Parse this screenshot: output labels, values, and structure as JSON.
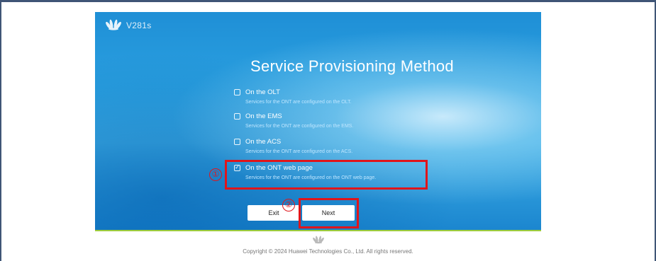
{
  "brand": {
    "model": "V281s"
  },
  "title": "Service Provisioning Method",
  "options": [
    {
      "label": "On the OLT",
      "description": "Services for the ONT are configured on the OLT.",
      "checked": false
    },
    {
      "label": "On the EMS",
      "description": "Services for the ONT are configured on the EMS.",
      "checked": false
    },
    {
      "label": "On the ACS",
      "description": "Services for the ONT are configured on the ACS.",
      "checked": false
    },
    {
      "label": "On the ONT web page",
      "description": "Services for the ONT are configured on the ONT web page.",
      "checked": true
    }
  ],
  "buttons": {
    "exit": "Exit",
    "next": "Next"
  },
  "annotations": {
    "marker1": "①",
    "marker2": "②",
    "highlight_color": "#e0151b"
  },
  "footer": {
    "copyright": "Copyright © 2024 Huawei Technologies Co., Ltd. All rights reserved."
  },
  "colors": {
    "accent_green": "#9ccc3d",
    "frame": "#3f5576"
  }
}
